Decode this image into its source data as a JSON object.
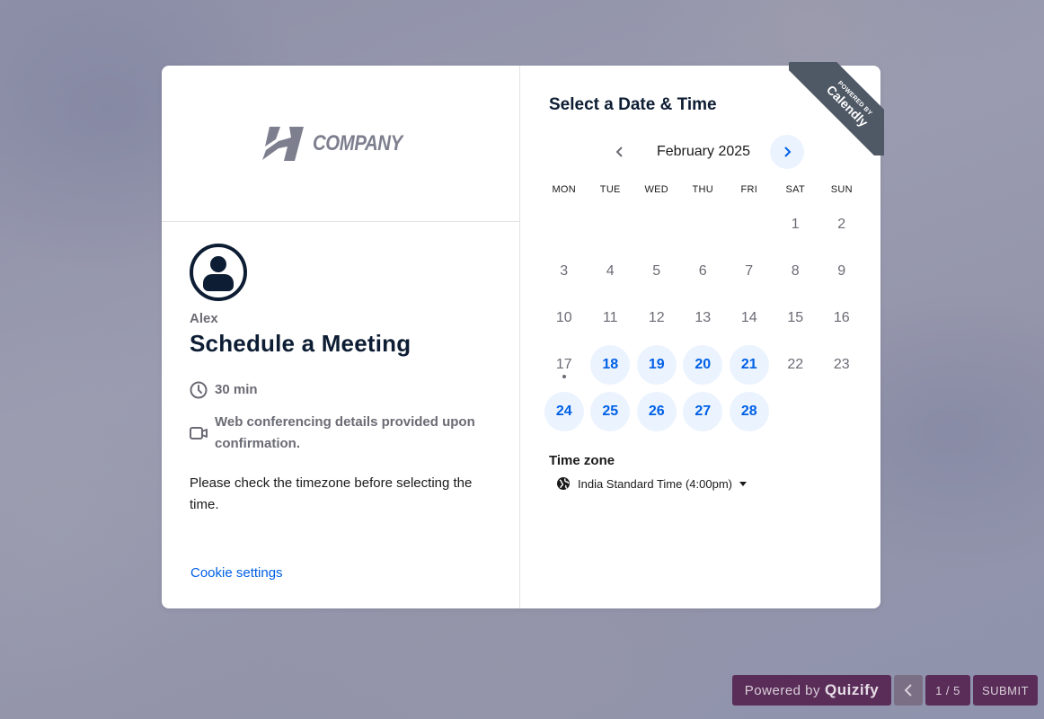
{
  "company_logo": {
    "text": "COMPANY"
  },
  "event": {
    "owner": "Alex",
    "title": "Schedule a Meeting",
    "duration": "30 min",
    "conferencing": "Web conferencing details provided upon confirmation.",
    "description": "Please check the timezone before selecting the time.",
    "cookie_link": "Cookie settings"
  },
  "calendar": {
    "heading": "Select a Date & Time",
    "month": "February 2025",
    "prev_icon": "chevron-left-icon",
    "next_icon": "chevron-right-icon",
    "weekdays": [
      "MON",
      "TUE",
      "WED",
      "THU",
      "FRI",
      "SAT",
      "SUN"
    ],
    "weeks": [
      [
        {
          "d": ""
        },
        {
          "d": ""
        },
        {
          "d": ""
        },
        {
          "d": ""
        },
        {
          "d": ""
        },
        {
          "d": "1"
        },
        {
          "d": "2"
        }
      ],
      [
        {
          "d": "3"
        },
        {
          "d": "4"
        },
        {
          "d": "5"
        },
        {
          "d": "6"
        },
        {
          "d": "7"
        },
        {
          "d": "8"
        },
        {
          "d": "9"
        }
      ],
      [
        {
          "d": "10"
        },
        {
          "d": "11"
        },
        {
          "d": "12"
        },
        {
          "d": "13"
        },
        {
          "d": "14"
        },
        {
          "d": "15"
        },
        {
          "d": "16"
        }
      ],
      [
        {
          "d": "17",
          "today": true
        },
        {
          "d": "18",
          "available": true
        },
        {
          "d": "19",
          "available": true
        },
        {
          "d": "20",
          "available": true
        },
        {
          "d": "21",
          "available": true
        },
        {
          "d": "22"
        },
        {
          "d": "23"
        }
      ],
      [
        {
          "d": "24",
          "available": true
        },
        {
          "d": "25",
          "available": true
        },
        {
          "d": "26",
          "available": true
        },
        {
          "d": "27",
          "available": true
        },
        {
          "d": "28",
          "available": true
        },
        {
          "d": ""
        },
        {
          "d": ""
        }
      ]
    ]
  },
  "timezone": {
    "label": "Time zone",
    "value": "India Standard Time (4:00pm)",
    "icon": "globe-icon"
  },
  "ribbon": {
    "small": "POWERED BY",
    "brand": "Calendly"
  },
  "quizify": {
    "powered_prefix": "Powered by",
    "powered_brand": "Quizify",
    "page": "1 / 5",
    "submit": "SUBMIT"
  },
  "colors": {
    "accent": "#0060e6",
    "available_bg": "#ebf3fe",
    "text_dark": "#0d1d33",
    "quizify_bg": "#5a2d59",
    "ribbon_bg": "#4f5865"
  }
}
